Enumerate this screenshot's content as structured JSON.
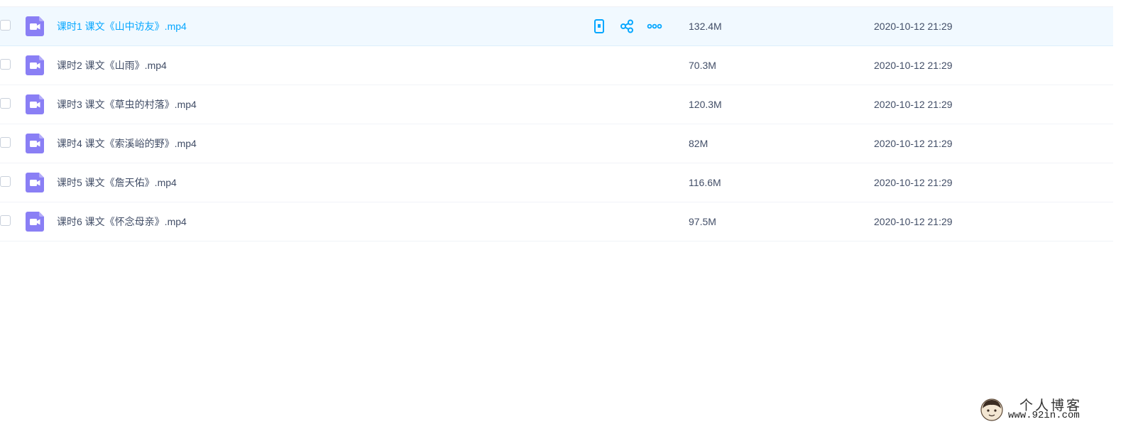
{
  "files": [
    {
      "name": "课时1 课文《山中访友》.mp4",
      "size": "132.4M",
      "modified": "2020-10-12 21:29",
      "hovered": true
    },
    {
      "name": "课时2 课文《山雨》.mp4",
      "size": "70.3M",
      "modified": "2020-10-12 21:29",
      "hovered": false
    },
    {
      "name": "课时3 课文《草虫的村落》.mp4",
      "size": "120.3M",
      "modified": "2020-10-12 21:29",
      "hovered": false
    },
    {
      "name": "课时4 课文《索溪峪的野》.mp4",
      "size": "82M",
      "modified": "2020-10-12 21:29",
      "hovered": false
    },
    {
      "name": "课时5 课文《詹天佑》.mp4",
      "size": "116.6M",
      "modified": "2020-10-12 21:29",
      "hovered": false
    },
    {
      "name": "课时6 课文《怀念母亲》.mp4",
      "size": "97.5M",
      "modified": "2020-10-12 21:29",
      "hovered": false
    }
  ],
  "row_actions": [
    {
      "icon": "phone-icon"
    },
    {
      "icon": "share-icon"
    },
    {
      "icon": "more-icon"
    }
  ],
  "watermark": {
    "title": "个人博客",
    "url": "www.92in.com"
  },
  "colors": {
    "accent": "#06a7ff",
    "video_icon": "#8a7ff5",
    "hover_row": "#f1f9ff",
    "text": "#424e67"
  }
}
